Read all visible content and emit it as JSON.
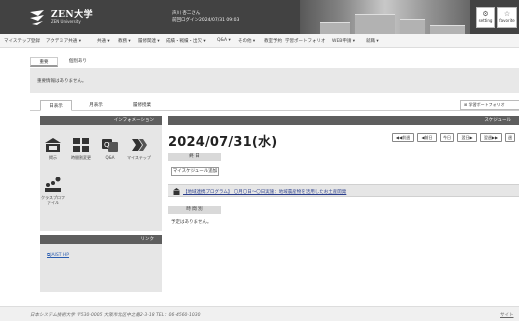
{
  "header": {
    "logo_name": "ZEN大学",
    "logo_sub": "ZEN University",
    "user_line1": "声川 杏二さん",
    "user_line2": "前回ログイン2024/07/31 09:03",
    "buttons": [
      {
        "label": "setting",
        "icon": "gear-icon"
      },
      {
        "label": "favorite",
        "icon": "star-icon"
      }
    ]
  },
  "menu": {
    "items": [
      "マイステップ登録",
      "アクデミア共通 ▾",
      "共通 ▾",
      "教務 ▾",
      "履修関連 ▾",
      "成績・戦績・出欠 ▾",
      "Q&A ▾",
      "その他 ▾",
      "教室予約",
      "学習ポートフォリオ",
      "WEB申請 ▾",
      "就職 ▾"
    ]
  },
  "notice": {
    "tabs": [
      "重要",
      "個別あり"
    ],
    "message": "重要情報はありません。"
  },
  "view_tabs": [
    "日表示",
    "月表示",
    "履修授業"
  ],
  "portfolio_button": "学習ポートフォリオ",
  "sidebar": {
    "info_title": "インフォメーション",
    "info_icons": [
      {
        "icon": "bulletin-icon",
        "label": "掲示"
      },
      {
        "icon": "class-change-icon",
        "label": "時間割変更"
      },
      {
        "icon": "qa-icon",
        "label": "Q&A"
      },
      {
        "icon": "my-step-icon",
        "label": "マイステップ"
      },
      {
        "icon": "class-profile-icon",
        "label": "クラスプロファイル"
      }
    ],
    "link_title": "リンク",
    "links": [
      "JAIST HP"
    ]
  },
  "schedule": {
    "title": "スケジュール",
    "date": "2024/07/31(水)",
    "nav_buttons": [
      "◀◀前週",
      "◀前日",
      "今日",
      "翌日▶",
      "翌週▶▶",
      "週"
    ],
    "day_label": "終 日",
    "add_button": "マイスケジュール追加",
    "event": "【地域連携プログラム】 〇月〇日～〇日実施：地域農産物を活用したお土産開発",
    "timeslot_label": "時 間 別",
    "empty_message": "予定はありません。"
  },
  "footer": {
    "text": "日本システム技術大学 〒530-0005 大阪市北区中之島2-3-18 TEL：06-4560-1030",
    "link": "サイト"
  }
}
